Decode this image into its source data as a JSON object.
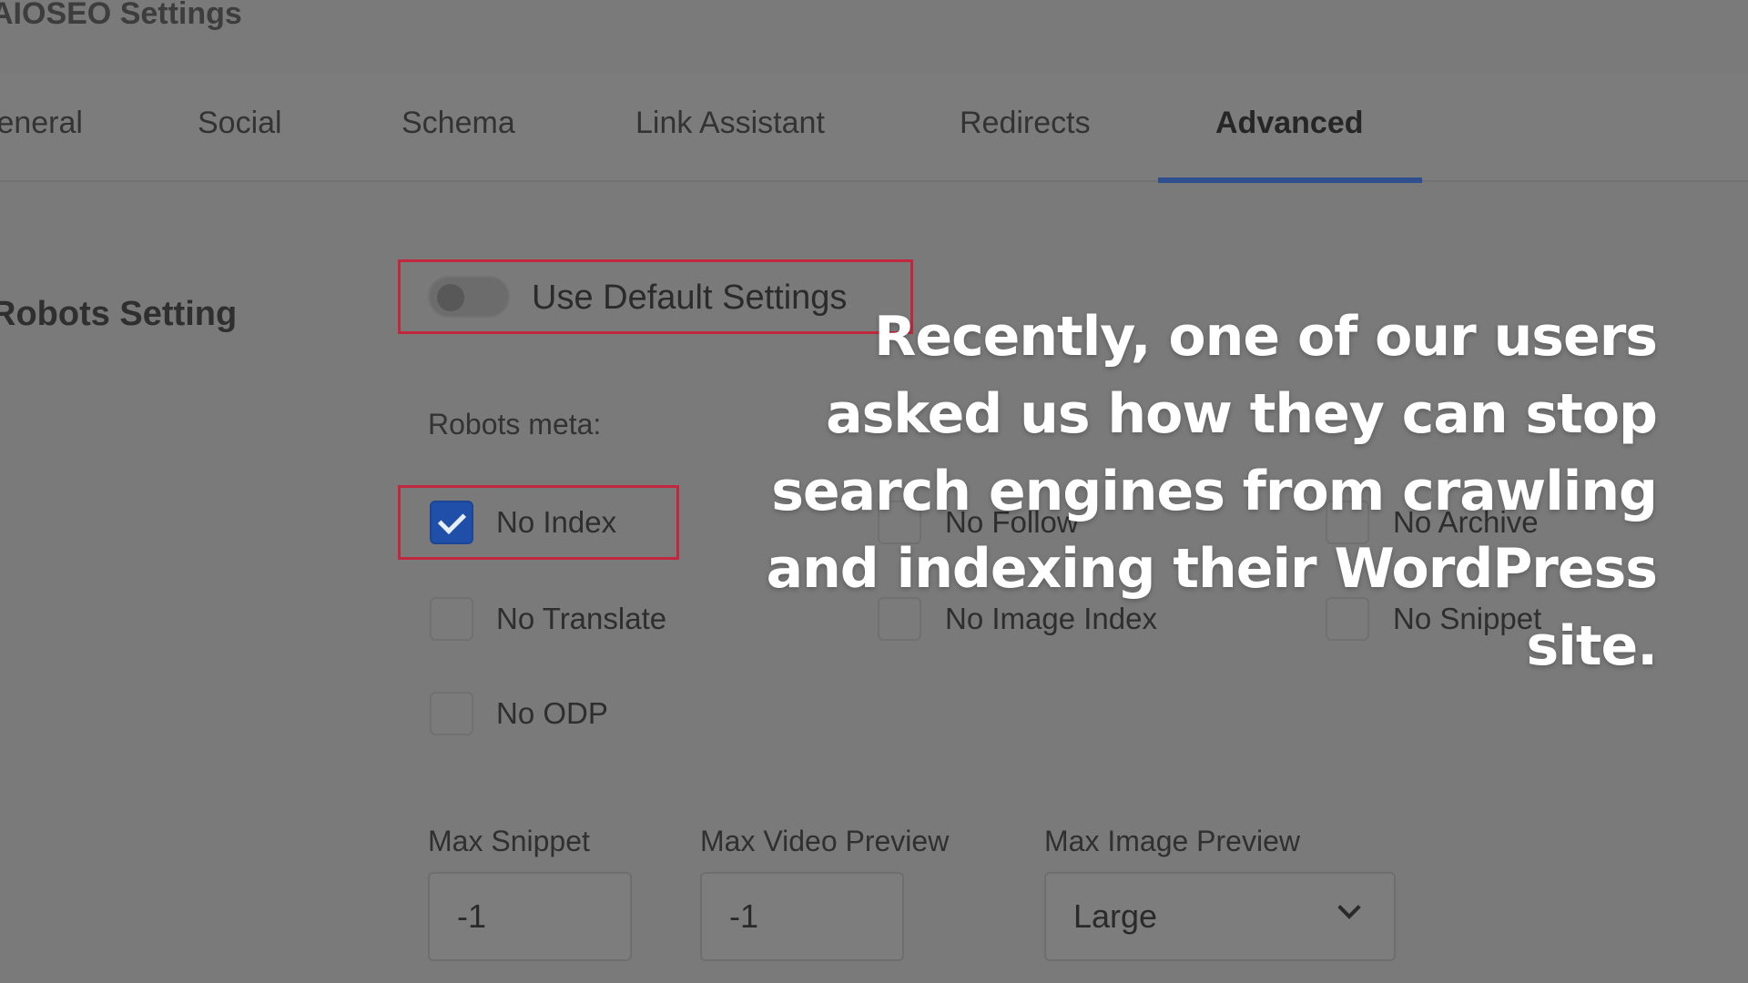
{
  "page": {
    "title": "AIOSEO Settings"
  },
  "tabs": [
    {
      "label": "General"
    },
    {
      "label": "Social"
    },
    {
      "label": "Schema"
    },
    {
      "label": "Link Assistant"
    },
    {
      "label": "Redirects"
    },
    {
      "label": "Advanced",
      "active": true
    }
  ],
  "robots": {
    "section_label": "Robots Setting",
    "default_toggle_label": "Use Default Settings",
    "default_toggle_on": false,
    "meta_label": "Robots meta:",
    "options": [
      {
        "label": "No Index",
        "checked": true
      },
      {
        "label": "No Follow",
        "checked": false
      },
      {
        "label": "No Archive",
        "checked": false
      },
      {
        "label": "No Translate",
        "checked": false
      },
      {
        "label": "No Image Index",
        "checked": false
      },
      {
        "label": "No Snippet",
        "checked": false
      },
      {
        "label": "No ODP",
        "checked": false
      }
    ]
  },
  "fields": {
    "max_snippet": {
      "label": "Max Snippet",
      "value": "-1"
    },
    "max_video_preview": {
      "label": "Max Video Preview",
      "value": "-1"
    },
    "max_image_preview": {
      "label": "Max Image Preview",
      "value": "Large"
    }
  },
  "overlay": {
    "caption": "Recently, one of our users asked us how they can stop search engines from crawling and indexing their WordPress site."
  },
  "colors": {
    "accent": "#1f4fa8",
    "highlight": "#c3273d",
    "tab_underline": "#2d4f8e",
    "background_dim": "#7a7a7a",
    "caption_text": "#ffffff"
  }
}
